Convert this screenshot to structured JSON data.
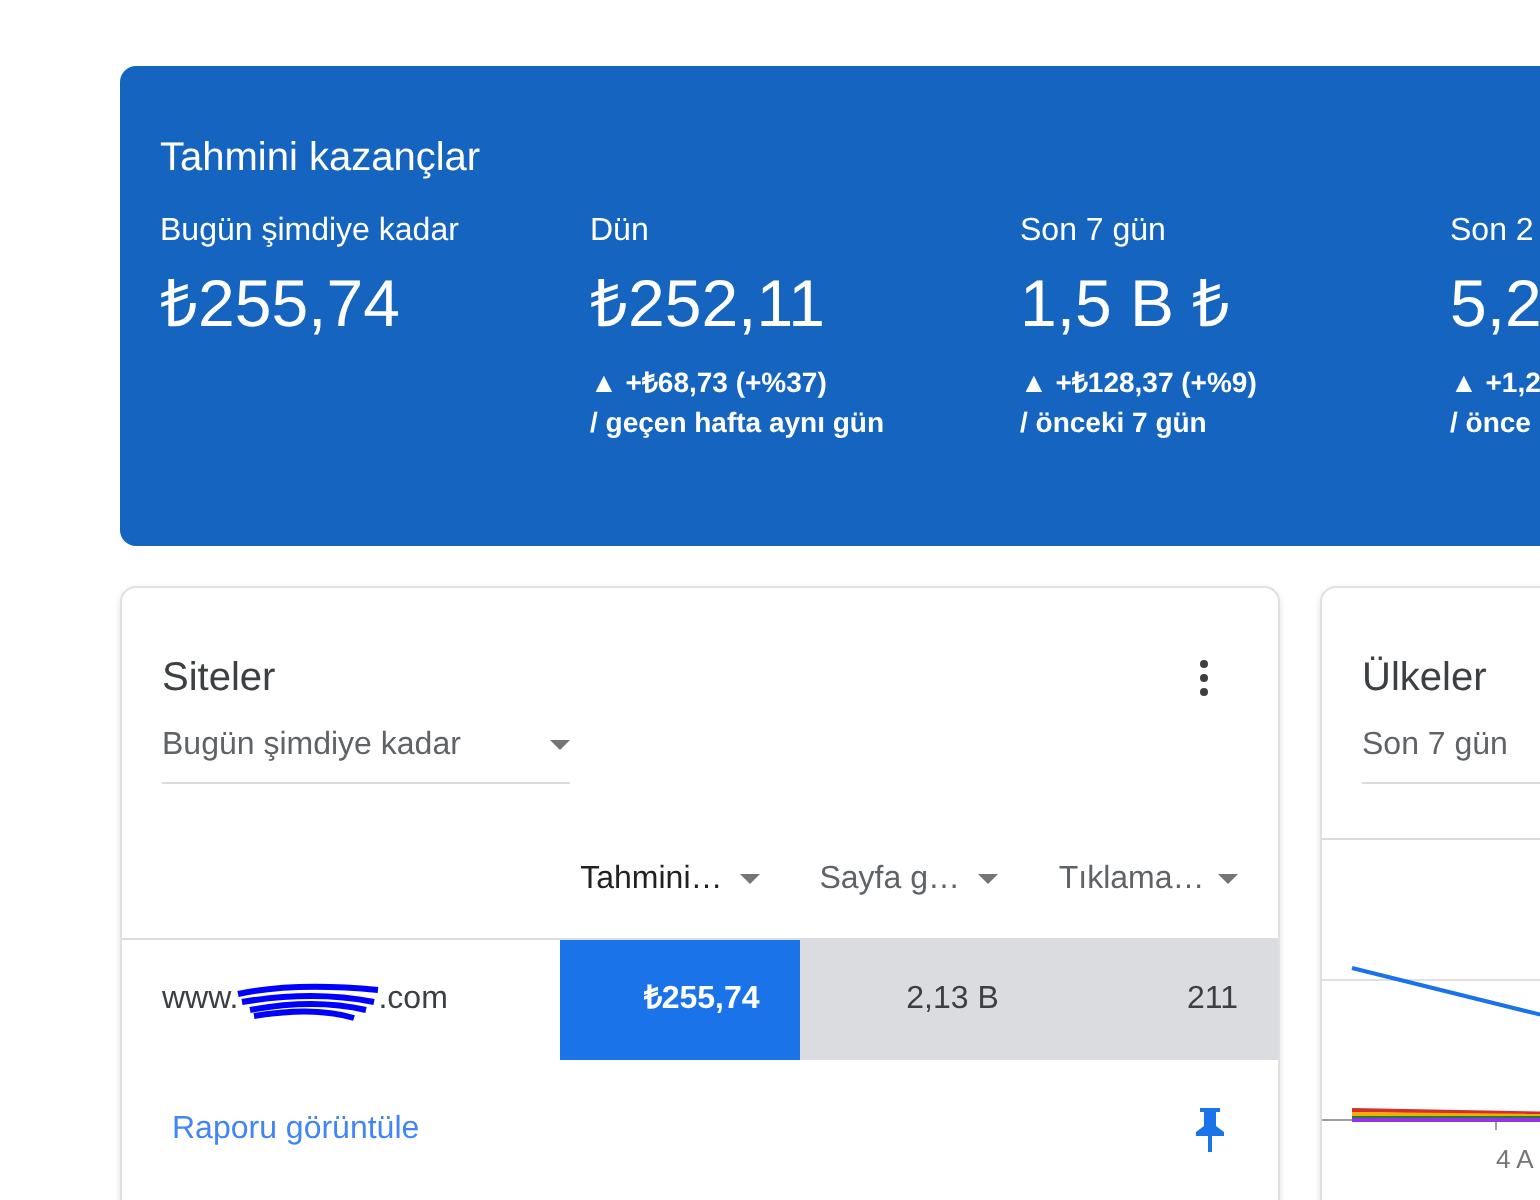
{
  "earnings": {
    "title": "Tahmini kazançlar",
    "periods": [
      {
        "label": "Bugün şimdiye kadar",
        "value": "₺255,74"
      },
      {
        "label": "Dün",
        "value": "₺252,11",
        "change": "▲ +₺68,73 (+%37)",
        "comparison": "/ geçen hafta aynı gün"
      },
      {
        "label": "Son 7 gün",
        "value": "1,5 B ₺",
        "change": "▲ +₺128,37 (+%9)",
        "comparison": "/ önceki 7 gün"
      },
      {
        "label": "Son 2",
        "value": "5,2",
        "change": "▲ +1,2",
        "comparison": "/ önce"
      }
    ]
  },
  "sites": {
    "title": "Siteler",
    "period": "Bugün şimdiye kadar",
    "columns": [
      {
        "label": "Tahmini…",
        "selected": true
      },
      {
        "label": "Sayfa g…",
        "selected": false
      },
      {
        "label": "Tıklama…",
        "selected": false
      }
    ],
    "rows": [
      {
        "site_prefix": "www.",
        "site_suffix": ".com",
        "cells": [
          "₺255,74",
          "2,13 B",
          "211"
        ]
      }
    ],
    "link": "Raporu görüntüle"
  },
  "countries": {
    "title": "Ülkeler",
    "period": "Son 7 gün",
    "x_label": "4 A"
  }
}
